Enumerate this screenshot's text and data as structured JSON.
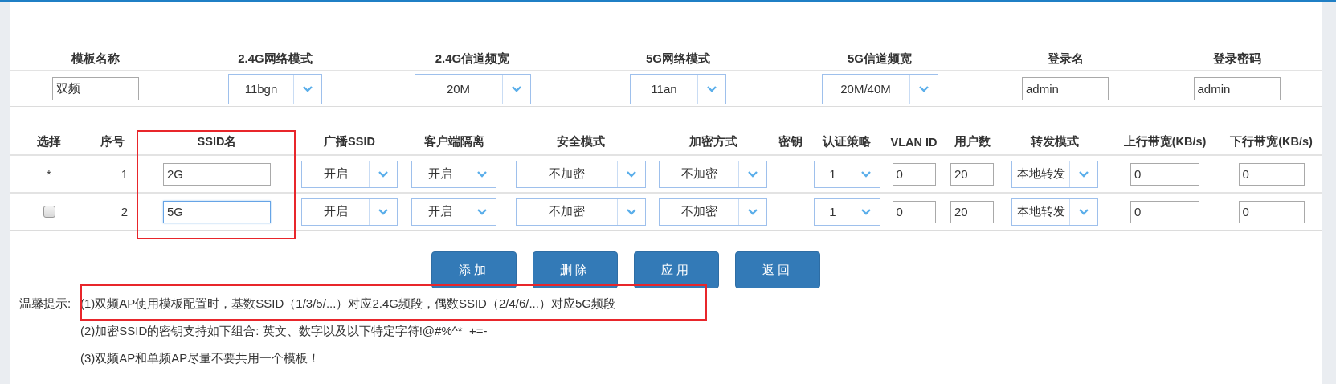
{
  "template": {
    "columns": [
      {
        "label": "模板名称",
        "kind": "input",
        "value": "双频"
      },
      {
        "label": "2.4G网络模式",
        "kind": "select",
        "value": "11bgn"
      },
      {
        "label": "2.4G信道频宽",
        "kind": "select",
        "value": "20M"
      },
      {
        "label": "5G网络模式",
        "kind": "select",
        "value": "11an"
      },
      {
        "label": "5G信道频宽",
        "kind": "select",
        "value": "20M/40M"
      },
      {
        "label": "登录名",
        "kind": "input",
        "value": "admin"
      },
      {
        "label": "登录密码",
        "kind": "input",
        "value": "admin"
      }
    ]
  },
  "ssid_table": {
    "columns": [
      "选择",
      "序号",
      "SSID名",
      "广播SSID",
      "客户端隔离",
      "安全模式",
      "加密方式",
      "密钥",
      "认证策略",
      "VLAN ID",
      "用户数",
      "转发模式",
      "上行带宽(KB/s)",
      "下行带宽(KB/s)"
    ],
    "rows": [
      {
        "cells": [
          {
            "kind": "marker",
            "text": "*"
          },
          {
            "kind": "text",
            "text": "1"
          },
          {
            "kind": "input",
            "value": "2G",
            "focused": false
          },
          {
            "kind": "select",
            "value": "开启"
          },
          {
            "kind": "select",
            "value": "开启"
          },
          {
            "kind": "select",
            "value": "不加密"
          },
          {
            "kind": "select",
            "value": "不加密"
          },
          {
            "kind": "blank"
          },
          {
            "kind": "select",
            "value": "1"
          },
          {
            "kind": "input",
            "value": "0",
            "focused": false
          },
          {
            "kind": "input",
            "value": "20",
            "focused": false
          },
          {
            "kind": "select",
            "value": "本地转发"
          },
          {
            "kind": "input",
            "value": "0",
            "focused": false
          },
          {
            "kind": "input",
            "value": "0",
            "focused": false
          }
        ]
      },
      {
        "cells": [
          {
            "kind": "checkbox",
            "checked": false
          },
          {
            "kind": "text",
            "text": "2"
          },
          {
            "kind": "input",
            "value": "5G",
            "focused": true
          },
          {
            "kind": "select",
            "value": "开启"
          },
          {
            "kind": "select",
            "value": "开启"
          },
          {
            "kind": "select",
            "value": "不加密"
          },
          {
            "kind": "select",
            "value": "不加密"
          },
          {
            "kind": "blank"
          },
          {
            "kind": "select",
            "value": "1"
          },
          {
            "kind": "input",
            "value": "0",
            "focused": false
          },
          {
            "kind": "input",
            "value": "20",
            "focused": false
          },
          {
            "kind": "select",
            "value": "本地转发"
          },
          {
            "kind": "input",
            "value": "0",
            "focused": false
          },
          {
            "kind": "input",
            "value": "0",
            "focused": false
          }
        ]
      }
    ]
  },
  "buttons": [
    "添加",
    "删除",
    "应用",
    "返回"
  ],
  "tips": {
    "label": "温馨提示:",
    "items": [
      "(1)双频AP使用模板配置时，基数SSID（1/3/5/...）对应2.4G频段，偶数SSID（2/4/6/...）对应5G频段",
      "(2)加密SSID的密钥支持如下组合: 英文、数字以及以下特定字符!@#%^*_+=-",
      "(3)双频AP和单频AP尽量不要共用一个模板！"
    ]
  }
}
